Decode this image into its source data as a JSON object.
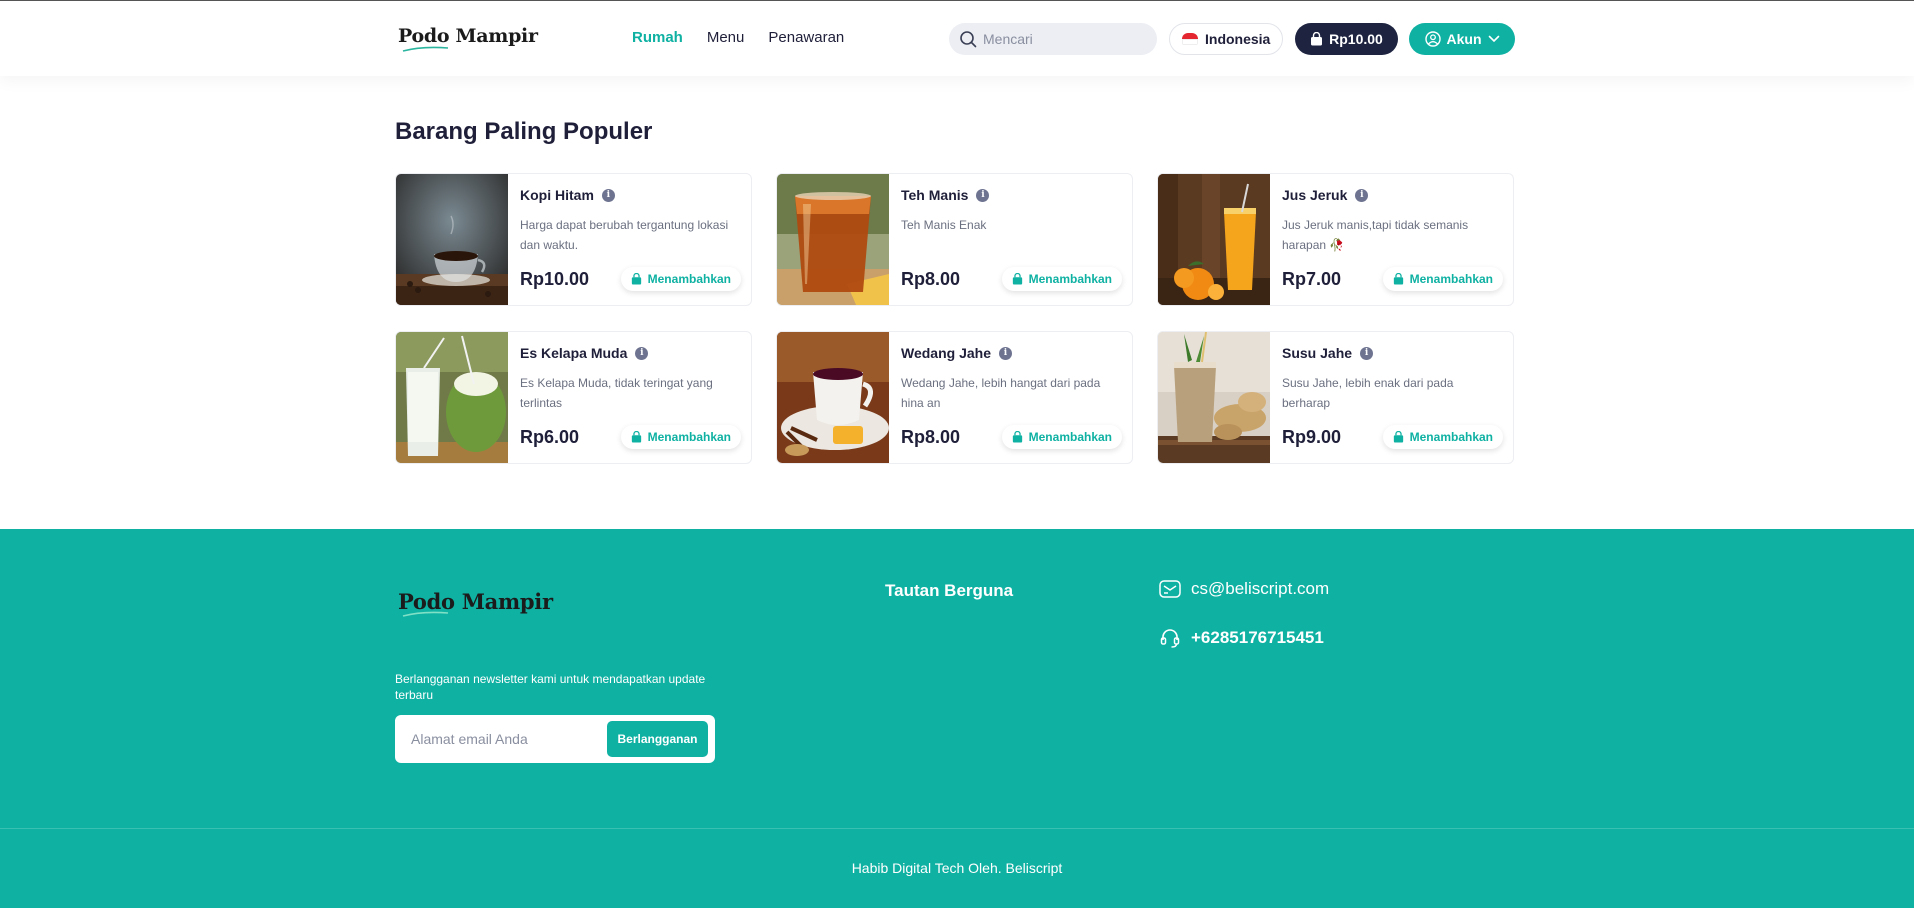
{
  "brand": {
    "name": "Podo Mampir"
  },
  "nav": {
    "items": [
      "Rumah",
      "Menu",
      "Penawaran"
    ]
  },
  "search": {
    "placeholder": "Mencari"
  },
  "language": {
    "label": "Indonesia"
  },
  "cart": {
    "total": "Rp10.00"
  },
  "account": {
    "label": "Akun"
  },
  "section": {
    "title": "Barang Paling Populer"
  },
  "products": [
    {
      "name": "Kopi Hitam",
      "desc": "Harga dapat berubah tergantung lokasi dan waktu.",
      "price": "Rp10.00",
      "add_label": "Menambahkan"
    },
    {
      "name": "Teh Manis",
      "desc": "Teh Manis Enak",
      "price": "Rp8.00",
      "add_label": "Menambahkan"
    },
    {
      "name": "Jus Jeruk",
      "desc": "Jus Jeruk manis,tapi tidak semanis harapan 🥀",
      "price": "Rp7.00",
      "add_label": "Menambahkan"
    },
    {
      "name": "Es Kelapa Muda",
      "desc": "Es Kelapa Muda, tidak teringat yang terlintas",
      "price": "Rp6.00",
      "add_label": "Menambahkan"
    },
    {
      "name": "Wedang Jahe",
      "desc": "Wedang Jahe, lebih hangat dari pada hina an",
      "price": "Rp8.00",
      "add_label": "Menambahkan"
    },
    {
      "name": "Susu Jahe",
      "desc": "Susu Jahe, lebih enak dari pada berharap",
      "price": "Rp9.00",
      "add_label": "Menambahkan"
    }
  ],
  "footer": {
    "newsletter_text": "Berlangganan newsletter kami untuk mendapatkan update terbaru",
    "email_placeholder": "Alamat email Anda",
    "subscribe_label": "Berlangganan",
    "links_title": "Tautan Berguna",
    "email": "cs@beliscript.com",
    "phone": "+6285176715451",
    "copyright": "Habib Digital Tech Oleh. Beliscript"
  },
  "colors": {
    "accent": "#0fb1a3",
    "dark": "#1e2340",
    "text": "#1f1f3a"
  },
  "icons": [
    "search-icon",
    "flag-icon",
    "bag-icon",
    "user-icon",
    "chevron-down-icon",
    "info-icon",
    "mail-icon",
    "headset-icon"
  ]
}
